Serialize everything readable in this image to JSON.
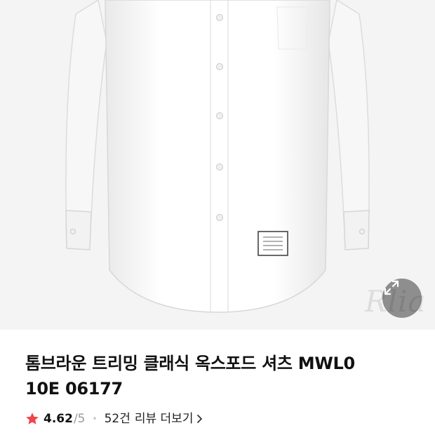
{
  "product": {
    "title_line1": "톰브라운 트리밍 클래식 옥스포드 셔츠 MWL0",
    "title_line2": "10E 06177",
    "watermark": "Rlia"
  },
  "rating": {
    "score": "4.62",
    "max": "/5",
    "review_count": "52건",
    "review_link_label": "리뷰 더보기"
  },
  "colors": {
    "star": "#f0434a",
    "zoom_button_bg": "rgba(0,0,0,0.42)"
  },
  "icons": {
    "zoom": "expand-diagonal-icon",
    "star": "star-icon",
    "chevron": "chevron-right-icon"
  }
}
